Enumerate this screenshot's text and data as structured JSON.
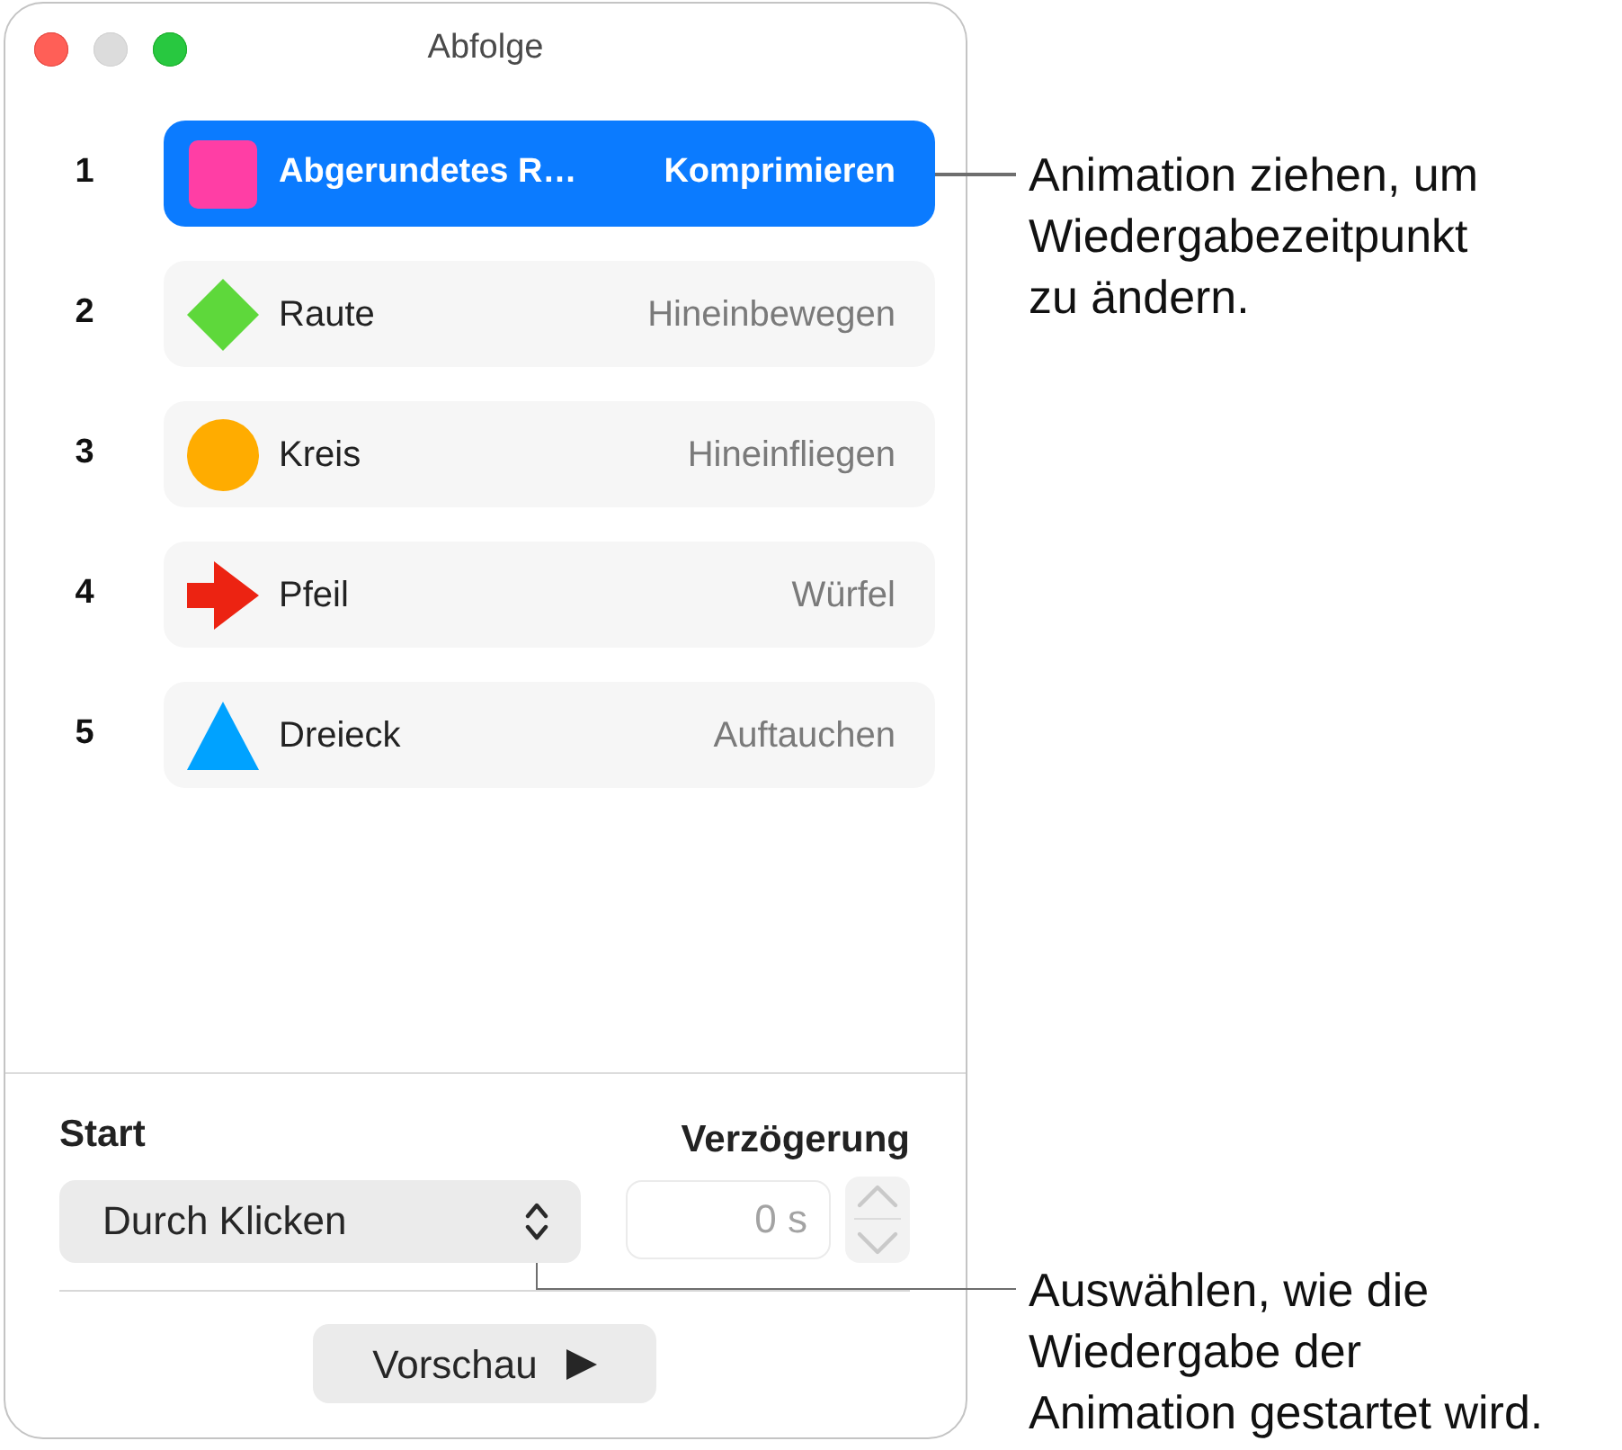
{
  "window": {
    "title": "Abfolge",
    "buttons": [
      {
        "kind": "close",
        "disabled": false
      },
      {
        "kind": "minimize",
        "disabled": true
      },
      {
        "kind": "zoom",
        "disabled": false
      }
    ]
  },
  "animations": [
    {
      "number": "1",
      "kind": "square",
      "color": "#ff3ea5",
      "name": "Abgerundetes R…",
      "effect": "Komprimieren",
      "selected": true
    },
    {
      "number": "2",
      "kind": "diamond",
      "color": "#5ed83b",
      "name": "Raute",
      "effect": "Hineinbewegen",
      "selected": false
    },
    {
      "number": "3",
      "kind": "circle",
      "color": "#ffac00",
      "name": "Kreis",
      "effect": "Hineinfliegen",
      "selected": false
    },
    {
      "number": "4",
      "kind": "arrow",
      "color": "#ec2312",
      "name": "Pfeil",
      "effect": "Würfel",
      "selected": false
    },
    {
      "number": "5",
      "kind": "triangle",
      "color": "#00a2ff",
      "name": "Dreieck",
      "effect": "Auftauchen",
      "selected": false
    }
  ],
  "start": {
    "label": "Start",
    "value": "Durch Klicken"
  },
  "delay": {
    "label": "Verzögerung",
    "value": "0 s",
    "disabled": true
  },
  "preview_button": {
    "label": "Vorschau"
  },
  "callouts": [
    {
      "text": "Animation ziehen, um Wiedergabezeitpunkt zu ändern."
    },
    {
      "text": "Auswählen, wie die Wiedergabe der Animation gestartet wird."
    }
  ]
}
